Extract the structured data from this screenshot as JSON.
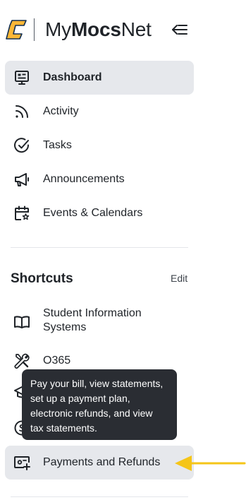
{
  "header": {
    "brand_part1": "My",
    "brand_part2": "Mocs",
    "brand_part3": "Net",
    "logo_icon": "utc-c-logo",
    "collapse_icon": "collapse-menu-icon"
  },
  "nav": {
    "items": [
      {
        "label": "Dashboard",
        "icon": "dashboard-icon",
        "active": true
      },
      {
        "label": "Activity",
        "icon": "rss-icon",
        "active": false
      },
      {
        "label": "Tasks",
        "icon": "check-circle-icon",
        "active": false
      },
      {
        "label": "Announcements",
        "icon": "megaphone-icon",
        "active": false
      },
      {
        "label": "Events & Calendars",
        "icon": "calendar-icon",
        "active": false
      }
    ]
  },
  "shortcuts": {
    "title": "Shortcuts",
    "edit_label": "Edit",
    "items": [
      {
        "label": "Student Information Systems",
        "icon": "book-icon"
      },
      {
        "label": "O365",
        "icon": "tools-icon"
      },
      {
        "label": "Payments and Refunds",
        "icon": "payment-card-icon"
      }
    ]
  },
  "tooltip": {
    "text": "Pay your bill, view statements, set up a payment plan, electronic refunds, and view tax statements."
  },
  "colors": {
    "accent_gold": "#fdb736",
    "brand_navy": "#112e51",
    "active_bg": "#e6e8ec",
    "tooltip_bg": "#2a2d33",
    "annotation_arrow": "#f5c518"
  }
}
